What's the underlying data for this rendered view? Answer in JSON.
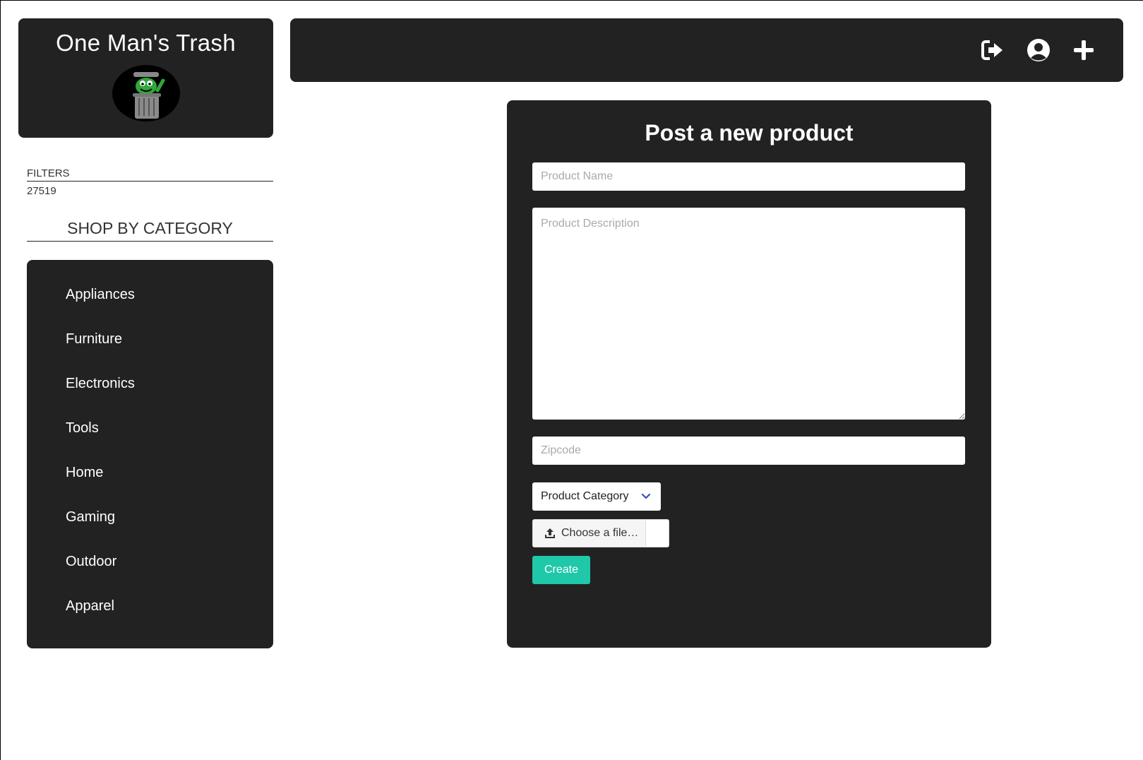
{
  "brand": {
    "title": "One Man's Trash",
    "logo_icon": "trash-can-character-logo"
  },
  "filters": {
    "label": "FILTERS",
    "zipcode_value": "27519"
  },
  "categories": {
    "heading": "SHOP BY CATEGORY",
    "items": [
      {
        "label": "Appliances"
      },
      {
        "label": "Furniture"
      },
      {
        "label": "Electronics"
      },
      {
        "label": "Tools"
      },
      {
        "label": "Home"
      },
      {
        "label": "Gaming"
      },
      {
        "label": "Outdoor"
      },
      {
        "label": "Apparel"
      }
    ]
  },
  "topbar": {
    "icons": [
      "sign-out-icon",
      "user-circle-icon",
      "plus-icon"
    ]
  },
  "form": {
    "title": "Post a new product",
    "product_name_placeholder": "Product Name",
    "product_description_placeholder": "Product Description",
    "zipcode_placeholder": "Zipcode",
    "category_select_label": "Product Category",
    "file_button_label": "Choose a file…",
    "create_button_label": "Create"
  },
  "colors": {
    "panel_bg": "#222222",
    "accent": "#1fc8a9",
    "chevron": "#3850b7"
  }
}
